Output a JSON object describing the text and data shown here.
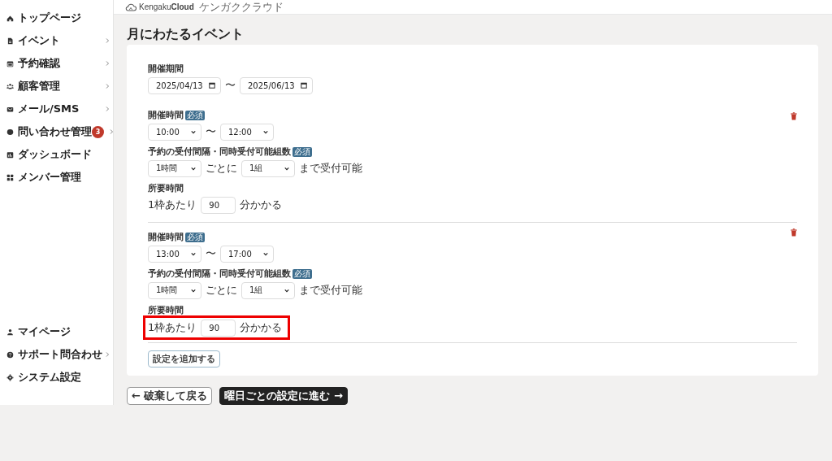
{
  "sidebar": {
    "items": [
      {
        "label": "トップページ",
        "kind": "home",
        "submenu": false
      },
      {
        "label": "イベント",
        "kind": "file",
        "submenu": true
      },
      {
        "label": "予約確認",
        "kind": "calendar",
        "submenu": true
      },
      {
        "label": "顧客管理",
        "kind": "people",
        "submenu": true
      },
      {
        "label": "メール/SMS",
        "kind": "mail",
        "submenu": true
      },
      {
        "label": "問い合わせ管理",
        "kind": "chat",
        "submenu": true,
        "badge": "3"
      },
      {
        "label": "ダッシュボード",
        "kind": "chart",
        "submenu": false
      },
      {
        "label": "メンバー管理",
        "kind": "grid",
        "submenu": false
      }
    ],
    "bottom_items": [
      {
        "label": "マイページ",
        "kind": "user",
        "submenu": false
      },
      {
        "label": "サポート問合わせ",
        "kind": "help",
        "submenu": true
      },
      {
        "label": "システム設定",
        "kind": "gear",
        "submenu": false
      }
    ]
  },
  "header": {
    "logo": "Kengaku**Cloud**",
    "tagline": "ケンガククラウド"
  },
  "page_title": "月にわたるイベント",
  "period": {
    "label": "開催期間",
    "start": "2025/04/13",
    "separator": "〜",
    "end": "2025/06/13"
  },
  "slots": [
    {
      "time_label": "開催時間",
      "time_required": "必須",
      "start": "10:00",
      "separator": "〜",
      "end": "12:00",
      "interval_label": "予約の受付間隔・同時受付可能組数",
      "interval_required": "必須",
      "interval": "1時間",
      "per": "ごとに",
      "groups": "1組",
      "until": "まで受付可能",
      "duration_label": "所要時間",
      "per_slot": "1枠あたり",
      "minutes": "90",
      "suffix": "分かかる",
      "highlighted": false
    },
    {
      "time_label": "開催時間",
      "time_required": "必須",
      "start": "13:00",
      "separator": "〜",
      "end": "17:00",
      "interval_label": "予約の受付間隔・同時受付可能組数",
      "interval_required": "必須",
      "interval": "1時間",
      "per": "ごとに",
      "groups": "1組",
      "until": "まで受付可能",
      "duration_label": "所要時間",
      "per_slot": "1枠あたり",
      "minutes": "90",
      "suffix": "分かかる",
      "highlighted": true
    }
  ],
  "add_button": "設定を追加する",
  "footer_buttons": [
    {
      "label": "← 破棄して戻る",
      "kind": "secondary"
    },
    {
      "label": "曜日ごとの設定に進む →",
      "kind": "primary"
    }
  ]
}
